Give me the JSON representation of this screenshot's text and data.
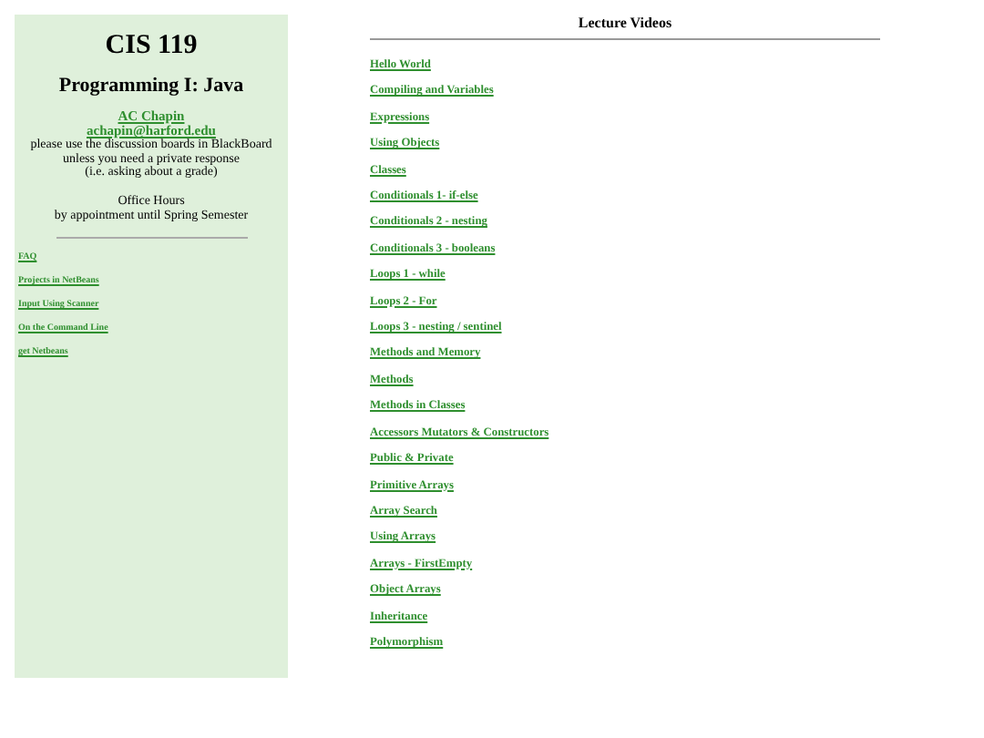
{
  "sidebar": {
    "course_code": "CIS 119",
    "course_title": "Programming I: Java",
    "instructor_link": "AC Chapin",
    "email_link": "achapin@harford.edu",
    "notes": [
      "please use the discussion boards in BlackBoard",
      "unless you need a private response",
      "(i.e. asking about a grade)"
    ],
    "office_hours": [
      "Office Hours",
      "by appointment until Spring Semester"
    ],
    "links": [
      "FAQ",
      "Projects in NetBeans",
      "Input Using Scanner",
      "On the Command Line",
      "get Netbeans"
    ]
  },
  "main": {
    "title": "Lecture Videos",
    "links": [
      "Hello World",
      "Compiling and Variables",
      "Expressions",
      "Using Objects",
      "Classes",
      "Conditionals 1- if-else",
      "Conditionals 2 - nesting",
      "Conditionals 3 - booleans",
      "Loops 1 - while",
      "Loops 2 - For",
      "Loops 3 - nesting / sentinel",
      "Methods and Memory",
      "Methods",
      "Methods in Classes",
      "Accessors Mutators & Constructors",
      "Public & Private",
      "Primitive Arrays",
      "Array Search",
      "Using Arrays",
      "Arrays - FirstEmpty",
      "Object Arrays",
      "Inheritance",
      "Polymorphism"
    ]
  }
}
